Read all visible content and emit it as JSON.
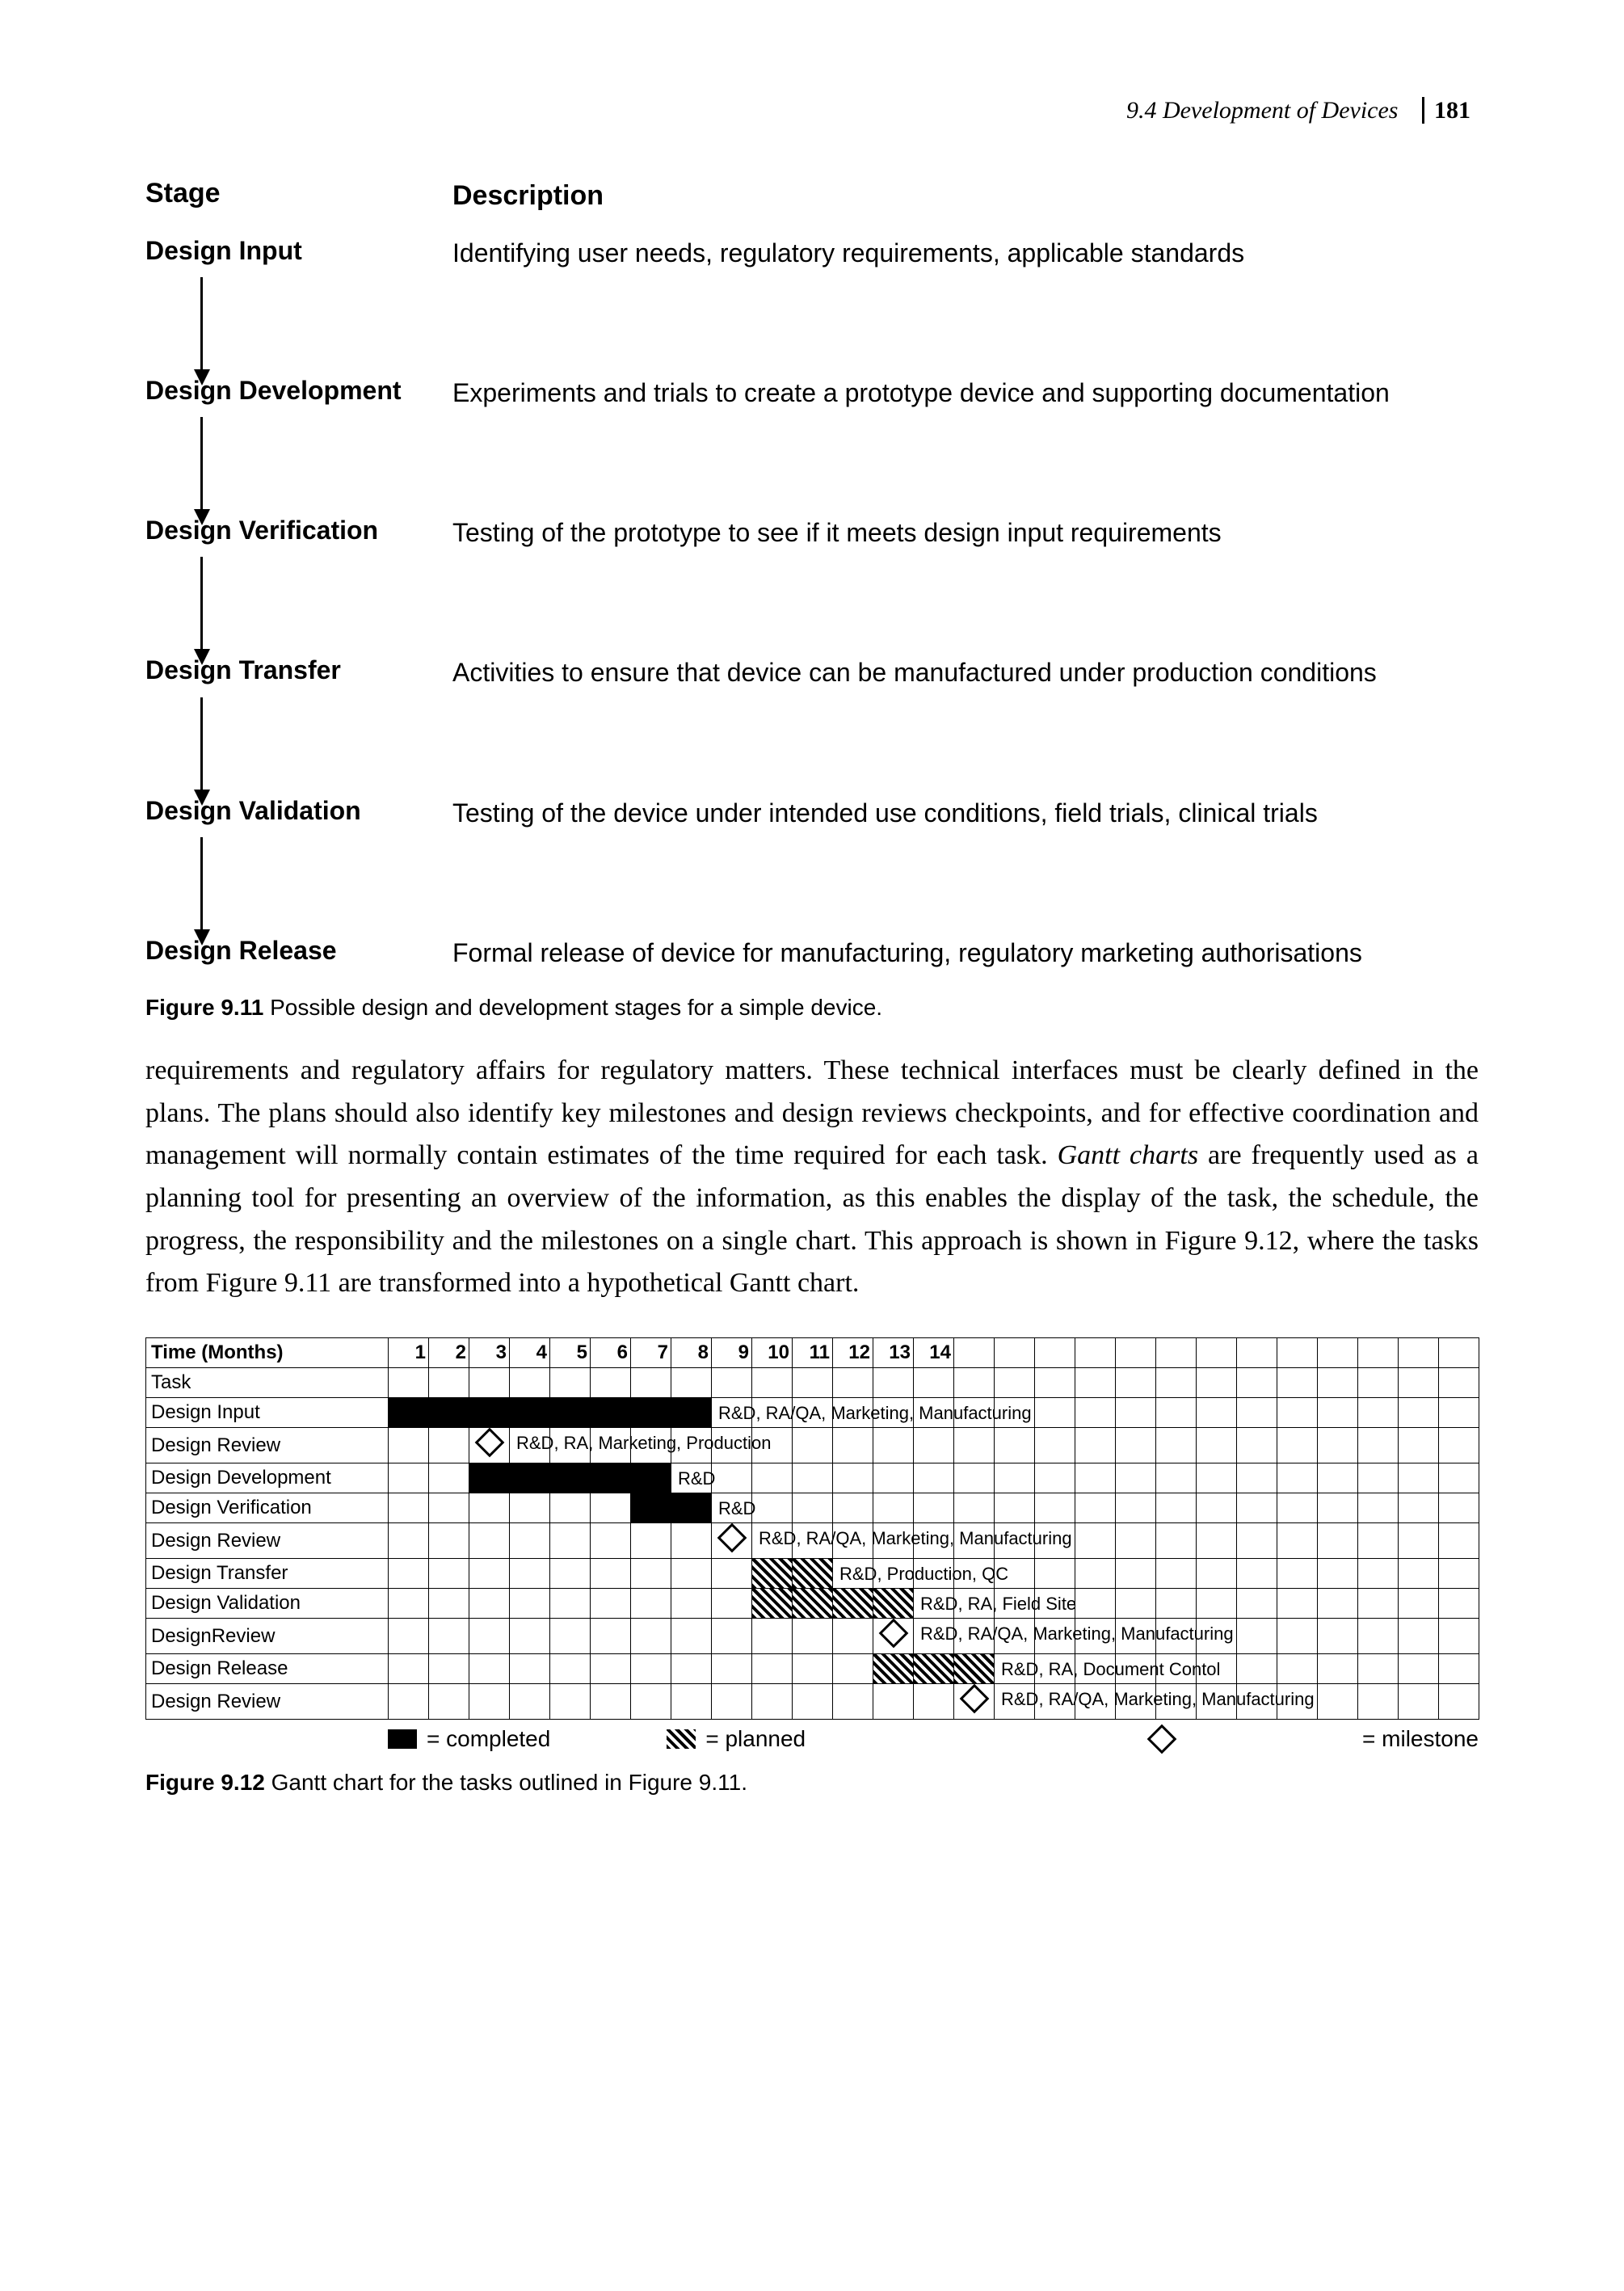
{
  "header": {
    "section": "9.4  Development of Devices",
    "page": "181"
  },
  "fig911": {
    "col1_header": "Stage",
    "col2_header": "Description",
    "rows": [
      {
        "stage": "Design Input",
        "desc": "Identifying user needs, regulatory requirements, applicable standards"
      },
      {
        "stage": "Design Development",
        "desc": "Experiments and trials to create a prototype device and supporting documentation"
      },
      {
        "stage": "Design Verification",
        "desc": "Testing of the prototype to see if it meets design input requirements"
      },
      {
        "stage": "Design Transfer",
        "desc": "Activities to ensure that device can be manufactured under production conditions"
      },
      {
        "stage": "Design Validation",
        "desc": "Testing of the device under intended use conditions, field trials, clinical trials"
      },
      {
        "stage": "Design Release",
        "desc": "Formal release of device for manufacturing, regulatory marketing authorisations"
      }
    ],
    "caption_num": "Figure 9.11",
    "caption_text": "  Possible design and development stages for a simple device."
  },
  "body": {
    "para": "requirements and regulatory affairs for regulatory matters. These technical interfaces must be clearly defined in the plans. The plans should also identify key milestones and design reviews checkpoints, and for effective coordination and management will normally contain estimates of the time required for each task. ",
    "ital": "Gantt charts",
    "para2": " are frequently used as a planning tool for presenting an overview of the information, as this enables the display of the task, the schedule, the progress, the responsibility and the milestones on a single chart. This approach is shown in Figure 9.12, where the tasks from Figure 9.11 are transformed into a hypothetical Gantt chart."
  },
  "chart_data": {
    "type": "gantt",
    "x_header": "Time (Months)",
    "task_header": "Task",
    "months": [
      "1",
      "2",
      "3",
      "4",
      "5",
      "6",
      "7",
      "8",
      "9",
      "10",
      "11",
      "12",
      "13",
      "14"
    ],
    "total_cols": 27,
    "tasks": [
      {
        "name": "Design Input",
        "completed": [
          1,
          8
        ],
        "label": "R&D, RA/QA, Marketing, Manufacturing"
      },
      {
        "name": "Design Review",
        "milestone_at": 2.5,
        "label": "R&D, RA, Marketing, Production"
      },
      {
        "name": "Design Development",
        "completed": [
          3,
          7
        ],
        "label": "R&D"
      },
      {
        "name": "Design Verification",
        "completed": [
          7,
          8
        ],
        "label": "R&D"
      },
      {
        "name": "Design Review",
        "milestone_at": 9,
        "label": "R&D, RA/QA, Marketing, Manufacturing"
      },
      {
        "name": "Design Transfer",
        "planned": [
          10,
          11
        ],
        "label": "R&D, Production, QC"
      },
      {
        "name": "Design Validation",
        "planned": [
          10,
          13
        ],
        "label": "R&D, RA, Field Site"
      },
      {
        "name": "DesignReview",
        "milestone_at": 13,
        "label": "R&D, RA/QA, Marketing, Manufacturing"
      },
      {
        "name": "Design Release",
        "planned": [
          13,
          15
        ],
        "label": "R&D, RA, Document Contol"
      },
      {
        "name": "Design Review",
        "milestone_at": 15,
        "label": "R&D, RA/QA, Marketing, Manufacturing"
      }
    ],
    "legend": {
      "completed": "= completed",
      "planned": "= planned",
      "milestone": "= milestone"
    }
  },
  "fig912": {
    "caption_num": "Figure 9.12",
    "caption_text": "  Gantt chart for the tasks outlined in Figure 9.11."
  }
}
